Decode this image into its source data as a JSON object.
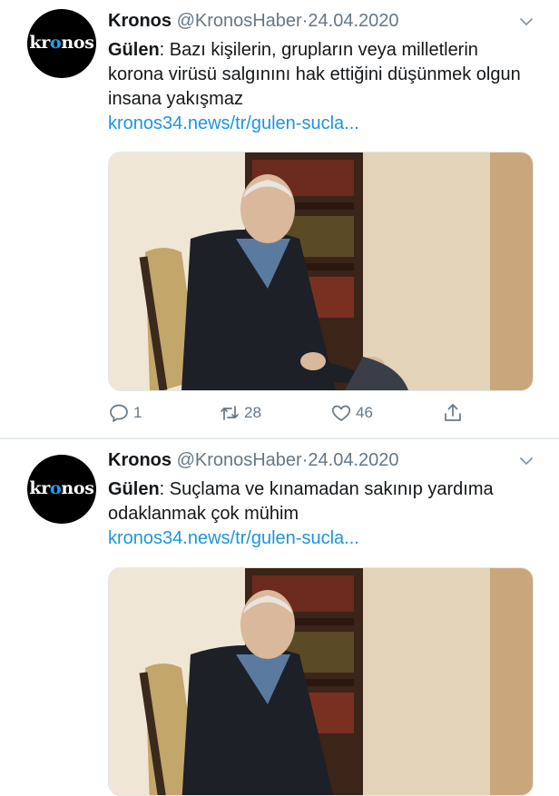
{
  "tweets": [
    {
      "name": "Kronos",
      "handle": "@KronosHaber",
      "separator": "·",
      "date": "24.04.2020",
      "avatar_text_pre": "kr",
      "avatar_text_o": "o",
      "avatar_text_post": "nos",
      "author_prefix": "Gülen",
      "text": ": Bazı kişilerin, grupların veya milletlerin korona virüsü salgınını hak ettiğini düşünmek olgun insana yakışmaz",
      "link": "kronos34.news/tr/gulen-sucla...",
      "replies": "1",
      "retweets": "28",
      "likes": "46"
    },
    {
      "name": "Kronos",
      "handle": "@KronosHaber",
      "separator": "·",
      "date": "24.04.2020",
      "avatar_text_pre": "kr",
      "avatar_text_o": "o",
      "avatar_text_post": "nos",
      "author_prefix": "Gülen",
      "text": ": Suçlama ve kınamadan sakınıp yardıma odaklanmak çok mühim",
      "link": "kronos34.news/tr/gulen-sucla..."
    }
  ],
  "icons": {
    "reply": "reply-icon",
    "retweet": "retweet-icon",
    "like": "heart-icon",
    "share": "share-icon",
    "menu": "chevron-down-icon"
  },
  "colors": {
    "link": "#1b95e0",
    "secondary_text": "#657786",
    "avatar_bg": "#000000",
    "avatar_accent": "#1da1f2"
  }
}
